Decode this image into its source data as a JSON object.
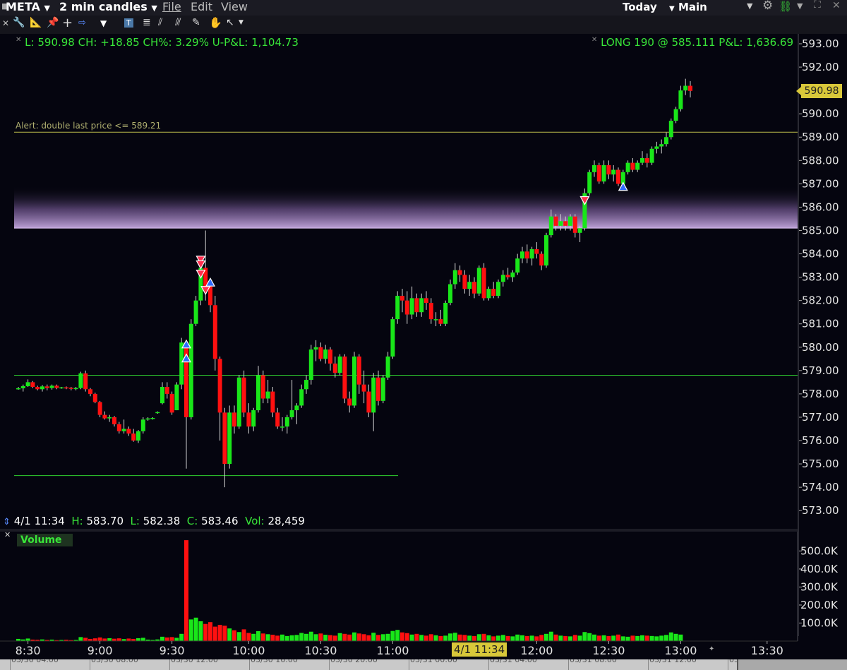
{
  "topbar": {
    "symbol": "META",
    "interval": "2 min candles",
    "menu_file": "File",
    "menu_edit": "Edit",
    "menu_view": "View",
    "range": "Today",
    "layout": "Main"
  },
  "toolbar": {
    "tools": [
      "wrench-icon",
      "ruler-icon",
      "pin-icon",
      "crosshair-icon",
      "arrow-right-icon",
      "triangle-down-icon",
      "text-icon",
      "fib-icon",
      "annotation-icon",
      "pencil-icon",
      "eraser-icon",
      "hand-icon",
      "cursor-icon"
    ]
  },
  "quote": {
    "last": "L: 590.98",
    "change": "CH: +18.85",
    "change_pct": "CH%: 3.29%",
    "upnl": "U-P&L: 1,104.73",
    "position": "LONG 190 @ 585.111",
    "pnl": "P&L: 1,636.69"
  },
  "alert": {
    "text": "Alert: double last price <= 589.21",
    "price": 589.21
  },
  "last_price_label": "590.98",
  "crosshair_readout": {
    "time": "4/1 11:34",
    "h_label": "H:",
    "h": "583.70",
    "l_label": "L:",
    "l": "582.38",
    "c_label": "C:",
    "c": "583.46",
    "vol_label": "Vol:",
    "vol": "28,459"
  },
  "volume_panel": {
    "title": "Volume"
  },
  "time_cursor_label": "4/1 11:34",
  "date_strip": [
    "03/30 04:00",
    "03/30 08:00",
    "03/30 12:00",
    "03/30 16:00",
    "03/30 20:00",
    "03/31 00:00",
    "03/31 04:00",
    "03/31 08:00",
    "03/31 12:00",
    "03/31 16:00",
    "03/31 20:00",
    "04/01 00:00",
    "04/0"
  ],
  "colors": {
    "up": "#19e619",
    "down": "#ff1010",
    "bg": "#05050f",
    "zone": "#9a7fb5",
    "alert_line": "#b9b94a",
    "level_line": "#2fd02f",
    "marker_buy": "#2f6bff",
    "marker_sell": "#ff2f4f"
  },
  "chart_data": {
    "type": "candlestick",
    "y_ticks": [
      "593.00",
      "592.00",
      "591.00",
      "590.00",
      "589.00",
      "588.00",
      "587.00",
      "586.00",
      "585.00",
      "584.00",
      "583.00",
      "582.00",
      "581.00",
      "580.00",
      "579.00",
      "578.00",
      "577.00",
      "576.00",
      "575.00",
      "574.00",
      "573.00"
    ],
    "ylim": [
      572.6,
      593.3
    ],
    "x_ticks": [
      "8:30",
      "9:00",
      "9:30",
      "10:00",
      "10:30",
      "11:00",
      "12:00",
      "12:30",
      "13:00",
      "13:30"
    ],
    "volume_ticks": [
      "500.0K",
      "400.0K",
      "300.0K",
      "200.0K",
      "100.0K"
    ],
    "volume_ylim": [
      0,
      580000
    ],
    "resistance_zone": [
      585.1,
      586.3
    ],
    "level_lines": [
      578.8,
      574.5
    ],
    "candles": [
      [
        578.22,
        578.3,
        578.18,
        578.24
      ],
      [
        578.24,
        578.4,
        578.1,
        578.33
      ],
      [
        578.33,
        578.62,
        578.3,
        578.5
      ],
      [
        578.5,
        578.55,
        578.25,
        578.3
      ],
      [
        578.3,
        578.35,
        578.15,
        578.2
      ],
      [
        578.2,
        578.38,
        578.1,
        578.32
      ],
      [
        578.32,
        578.4,
        578.15,
        578.25
      ],
      [
        578.25,
        578.4,
        578.18,
        578.35
      ],
      [
        578.35,
        578.4,
        578.2,
        578.25
      ],
      [
        578.25,
        578.3,
        578.22,
        578.28
      ],
      [
        578.28,
        578.32,
        578.2,
        578.26
      ],
      [
        578.26,
        578.3,
        578.15,
        578.22
      ],
      [
        578.22,
        578.3,
        578.15,
        578.25
      ],
      [
        578.25,
        578.95,
        578.2,
        578.88
      ],
      [
        578.88,
        579.0,
        578.1,
        578.2
      ],
      [
        578.2,
        578.25,
        577.9,
        578.0
      ],
      [
        578.0,
        578.05,
        577.6,
        577.65
      ],
      [
        577.65,
        577.7,
        577.0,
        577.1
      ],
      [
        577.1,
        577.25,
        576.9,
        576.95
      ],
      [
        576.95,
        577.1,
        576.8,
        577.0
      ],
      [
        577.0,
        577.05,
        576.6,
        576.7
      ],
      [
        576.7,
        576.8,
        576.3,
        576.4
      ],
      [
        576.4,
        576.9,
        576.3,
        576.5
      ],
      [
        576.5,
        576.6,
        576.2,
        576.3
      ],
      [
        576.3,
        576.5,
        575.95,
        576.0
      ],
      [
        576.0,
        576.45,
        575.9,
        576.4
      ],
      [
        576.4,
        577.0,
        576.3,
        576.9
      ],
      [
        576.9,
        577.0,
        576.85,
        576.95
      ],
      [
        576.95,
        577.0,
        576.9,
        576.97
      ],
      [
        577.2,
        577.25,
        577.15,
        577.22
      ],
      [
        577.6,
        578.5,
        577.55,
        578.3
      ],
      [
        578.3,
        578.5,
        577.8,
        578.0
      ],
      [
        578.0,
        578.1,
        577.1,
        577.2
      ],
      [
        577.3,
        578.5,
        577.3,
        578.4
      ],
      [
        578.4,
        580.4,
        578.2,
        580.2
      ],
      [
        580.2,
        580.3,
        574.8,
        577.0
      ],
      [
        577.0,
        581.2,
        576.9,
        581.0
      ],
      [
        581.0,
        582.2,
        580.9,
        582.0
      ],
      [
        582.0,
        583.6,
        581.8,
        583.4
      ],
      [
        583.4,
        585.0,
        582.0,
        582.4
      ],
      [
        582.6,
        582.8,
        581.5,
        581.8
      ],
      [
        581.8,
        582.2,
        579.0,
        579.5
      ],
      [
        579.5,
        579.6,
        576.0,
        577.2
      ],
      [
        577.2,
        577.4,
        574.0,
        575.0
      ],
      [
        575.0,
        577.5,
        574.8,
        577.2
      ],
      [
        577.2,
        577.5,
        576.3,
        576.6
      ],
      [
        576.6,
        578.8,
        576.5,
        578.7
      ],
      [
        578.7,
        579.0,
        577.0,
        577.2
      ],
      [
        577.2,
        577.6,
        576.3,
        576.6
      ],
      [
        576.6,
        577.4,
        576.4,
        577.3
      ],
      [
        577.3,
        579.2,
        577.2,
        578.8
      ],
      [
        578.8,
        579.0,
        577.6,
        577.8
      ],
      [
        577.8,
        578.6,
        577.6,
        578.1
      ],
      [
        578.1,
        578.3,
        577.0,
        577.2
      ],
      [
        577.2,
        577.4,
        576.5,
        576.6
      ],
      [
        576.6,
        577.0,
        576.4,
        576.6
      ],
      [
        576.6,
        577.1,
        576.3,
        577.0
      ],
      [
        577.0,
        578.6,
        576.9,
        577.3
      ],
      [
        577.3,
        577.6,
        576.7,
        577.5
      ],
      [
        577.5,
        578.4,
        577.4,
        578.2
      ],
      [
        578.2,
        578.8,
        578.0,
        578.6
      ],
      [
        578.6,
        580.1,
        578.4,
        579.9
      ],
      [
        579.9,
        580.3,
        579.4,
        580.0
      ],
      [
        580.0,
        580.2,
        579.4,
        579.5
      ],
      [
        579.5,
        580.1,
        579.3,
        579.9
      ],
      [
        579.9,
        580.0,
        579.0,
        579.3
      ],
      [
        579.3,
        579.6,
        578.7,
        578.9
      ],
      [
        578.9,
        579.7,
        578.8,
        579.6
      ],
      [
        579.6,
        579.7,
        577.6,
        577.8
      ],
      [
        577.8,
        578.1,
        577.2,
        577.5
      ],
      [
        577.5,
        579.8,
        577.4,
        579.6
      ],
      [
        579.6,
        579.7,
        578.0,
        578.4
      ],
      [
        578.4,
        579.0,
        577.6,
        578.1
      ],
      [
        578.1,
        578.4,
        577.0,
        577.2
      ],
      [
        577.2,
        578.9,
        576.4,
        578.7
      ],
      [
        578.7,
        579.0,
        577.5,
        577.7
      ],
      [
        577.7,
        578.8,
        577.6,
        578.7
      ],
      [
        578.7,
        579.8,
        578.6,
        579.6
      ],
      [
        579.6,
        581.3,
        579.5,
        581.2
      ],
      [
        581.2,
        582.4,
        581.0,
        582.2
      ],
      [
        582.2,
        582.5,
        581.5,
        582.0
      ],
      [
        582.0,
        582.4,
        581.0,
        581.4
      ],
      [
        581.4,
        582.6,
        581.2,
        582.1
      ],
      [
        582.1,
        582.3,
        581.3,
        581.5
      ],
      [
        581.5,
        582.3,
        581.3,
        582.1
      ],
      [
        582.1,
        582.4,
        581.6,
        581.9
      ],
      [
        581.9,
        582.1,
        581.0,
        581.2
      ],
      [
        581.2,
        581.5,
        580.9,
        581.2
      ],
      [
        581.2,
        581.6,
        580.9,
        581.0
      ],
      [
        581.0,
        582.0,
        580.9,
        581.9
      ],
      [
        581.9,
        582.9,
        581.8,
        582.7
      ],
      [
        582.7,
        583.6,
        582.5,
        583.3
      ],
      [
        583.3,
        583.5,
        582.8,
        583.1
      ],
      [
        583.1,
        583.3,
        582.3,
        582.5
      ],
      [
        582.5,
        583.1,
        582.2,
        582.8
      ],
      [
        582.8,
        583.0,
        582.1,
        582.3
      ],
      [
        582.3,
        583.5,
        582.2,
        583.4
      ],
      [
        583.4,
        583.6,
        582.0,
        582.1
      ],
      [
        582.1,
        582.6,
        582.0,
        582.5
      ],
      [
        582.5,
        582.8,
        582.1,
        582.2
      ],
      [
        582.2,
        582.9,
        582.1,
        582.8
      ],
      [
        582.8,
        583.3,
        582.6,
        583.1
      ],
      [
        583.1,
        583.4,
        582.9,
        583.0
      ],
      [
        583.0,
        583.3,
        582.8,
        583.2
      ],
      [
        583.2,
        584.0,
        583.1,
        583.8
      ],
      [
        583.8,
        584.3,
        583.6,
        584.1
      ],
      [
        584.1,
        584.4,
        583.6,
        583.8
      ],
      [
        583.8,
        584.3,
        583.5,
        584.2
      ],
      [
        584.2,
        584.5,
        583.8,
        584.0
      ],
      [
        584.0,
        584.1,
        583.3,
        583.5
      ],
      [
        583.5,
        584.9,
        583.4,
        584.8
      ],
      [
        584.8,
        585.9,
        584.7,
        585.6
      ],
      [
        585.6,
        585.7,
        585.0,
        585.2
      ],
      [
        585.2,
        585.7,
        585.0,
        585.4
      ],
      [
        585.4,
        585.6,
        585.0,
        585.2
      ],
      [
        585.2,
        585.7,
        585.0,
        585.6
      ],
      [
        585.6,
        585.7,
        584.7,
        584.9
      ],
      [
        584.9,
        585.2,
        584.5,
        585.1
      ],
      [
        585.1,
        586.8,
        585.0,
        586.6
      ],
      [
        586.6,
        587.6,
        586.5,
        587.5
      ],
      [
        587.5,
        588.0,
        587.3,
        587.8
      ],
      [
        587.8,
        587.9,
        587.0,
        587.1
      ],
      [
        587.1,
        588.0,
        587.0,
        587.8
      ],
      [
        587.8,
        588.0,
        587.2,
        587.4
      ],
      [
        587.4,
        587.8,
        587.1,
        587.6
      ],
      [
        587.6,
        587.7,
        586.9,
        587.0
      ],
      [
        587.0,
        587.6,
        586.9,
        587.5
      ],
      [
        587.5,
        588.0,
        587.4,
        587.9
      ],
      [
        587.9,
        588.1,
        587.5,
        587.6
      ],
      [
        587.6,
        588.0,
        587.5,
        587.9
      ],
      [
        587.9,
        588.4,
        587.8,
        588.1
      ],
      [
        588.1,
        588.3,
        587.7,
        587.9
      ],
      [
        587.9,
        588.6,
        587.8,
        588.5
      ],
      [
        588.5,
        588.8,
        588.3,
        588.6
      ],
      [
        588.6,
        588.9,
        588.3,
        588.7
      ],
      [
        588.7,
        589.2,
        588.6,
        589.0
      ],
      [
        589.0,
        589.8,
        588.9,
        589.7
      ],
      [
        589.7,
        590.3,
        589.6,
        590.2
      ],
      [
        590.2,
        591.2,
        590.1,
        591.0
      ],
      [
        591.0,
        591.5,
        590.8,
        591.2
      ],
      [
        591.2,
        591.4,
        590.7,
        590.98
      ]
    ],
    "volumes": [
      12000,
      9000,
      14000,
      8000,
      7000,
      9000,
      6000,
      8000,
      5000,
      6000,
      7000,
      5000,
      6000,
      22000,
      18000,
      12000,
      15000,
      20000,
      14000,
      16000,
      13000,
      15000,
      11000,
      14000,
      12000,
      16000,
      18000,
      8000,
      6000,
      9000,
      24000,
      20000,
      22000,
      18000,
      40000,
      560000,
      120000,
      130000,
      110000,
      95000,
      105000,
      80000,
      90000,
      85000,
      70000,
      60000,
      50000,
      65000,
      45000,
      40000,
      55000,
      42000,
      38000,
      35000,
      30000,
      36000,
      28000,
      32000,
      34000,
      45000,
      40000,
      52000,
      38000,
      42000,
      35000,
      33000,
      30000,
      44000,
      40000,
      36000,
      48000,
      42000,
      38000,
      32000,
      46000,
      34000,
      38000,
      40000,
      56000,
      62000,
      48000,
      44000,
      36000,
      40000,
      34000,
      30000,
      38000,
      32000,
      28000,
      30000,
      42000,
      46000,
      36000,
      34000,
      30000,
      28000,
      38000,
      40000,
      32000,
      26000,
      30000,
      34000,
      28000,
      26000,
      36000,
      32000,
      28000,
      30000,
      26000,
      34000,
      40000,
      52000,
      36000,
      30000,
      28000,
      26000,
      34000,
      30000,
      50000,
      44000,
      36000,
      30000,
      32000,
      28000,
      30000,
      36000,
      26000,
      24000,
      30000,
      28000,
      32000,
      30000,
      28000,
      26000,
      30000,
      34000,
      48000,
      40000,
      36000
    ],
    "markers": [
      {
        "type": "sell",
        "i": 38,
        "price": 583.75
      },
      {
        "type": "sell",
        "i": 38,
        "price": 583.55
      },
      {
        "type": "sell",
        "i": 38,
        "price": 583.15
      },
      {
        "type": "sell",
        "i": 39,
        "price": 582.45
      },
      {
        "type": "buy",
        "i": 40,
        "price": 582.8
      },
      {
        "type": "buy",
        "i": 35,
        "price": 580.15
      },
      {
        "type": "buy",
        "i": 35,
        "price": 579.55
      },
      {
        "type": "sell",
        "i": 118,
        "price": 586.3
      },
      {
        "type": "buy",
        "i": 126,
        "price": 586.9
      }
    ]
  }
}
